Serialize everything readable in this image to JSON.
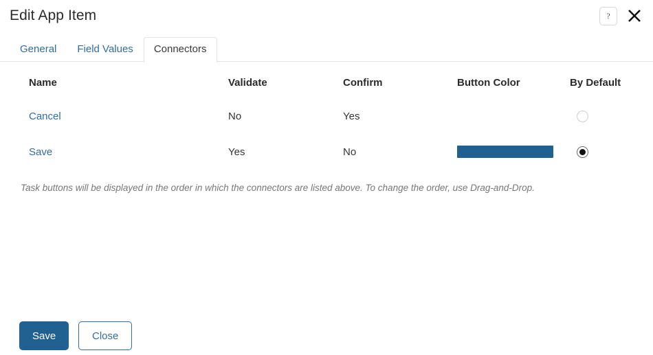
{
  "dialog": {
    "title": "Edit App Item",
    "help_icon": "question-mark-icon",
    "help_glyph": "?",
    "close_icon": "close-x-icon"
  },
  "tabs": [
    {
      "label": "General",
      "active": false
    },
    {
      "label": "Field Values",
      "active": false
    },
    {
      "label": "Connectors",
      "active": true
    }
  ],
  "table": {
    "headers": {
      "name": "Name",
      "validate": "Validate",
      "confirm": "Confirm",
      "button_color": "Button Color",
      "by_default": "By Default"
    },
    "rows": [
      {
        "name": "Cancel",
        "validate": "No",
        "confirm": "Yes",
        "button_color": "",
        "by_default": false
      },
      {
        "name": "Save",
        "validate": "Yes",
        "confirm": "No",
        "button_color": "#216192",
        "by_default": true
      }
    ],
    "note": "Task buttons will be displayed in the order in which the connectors are listed above. To change the order, use Drag-and-Drop."
  },
  "footer": {
    "save_label": "Save",
    "close_label": "Close"
  },
  "colors": {
    "accent": "#216192",
    "link": "#2f6da4",
    "border": "#e3e3e3",
    "note_text": "#777777"
  }
}
